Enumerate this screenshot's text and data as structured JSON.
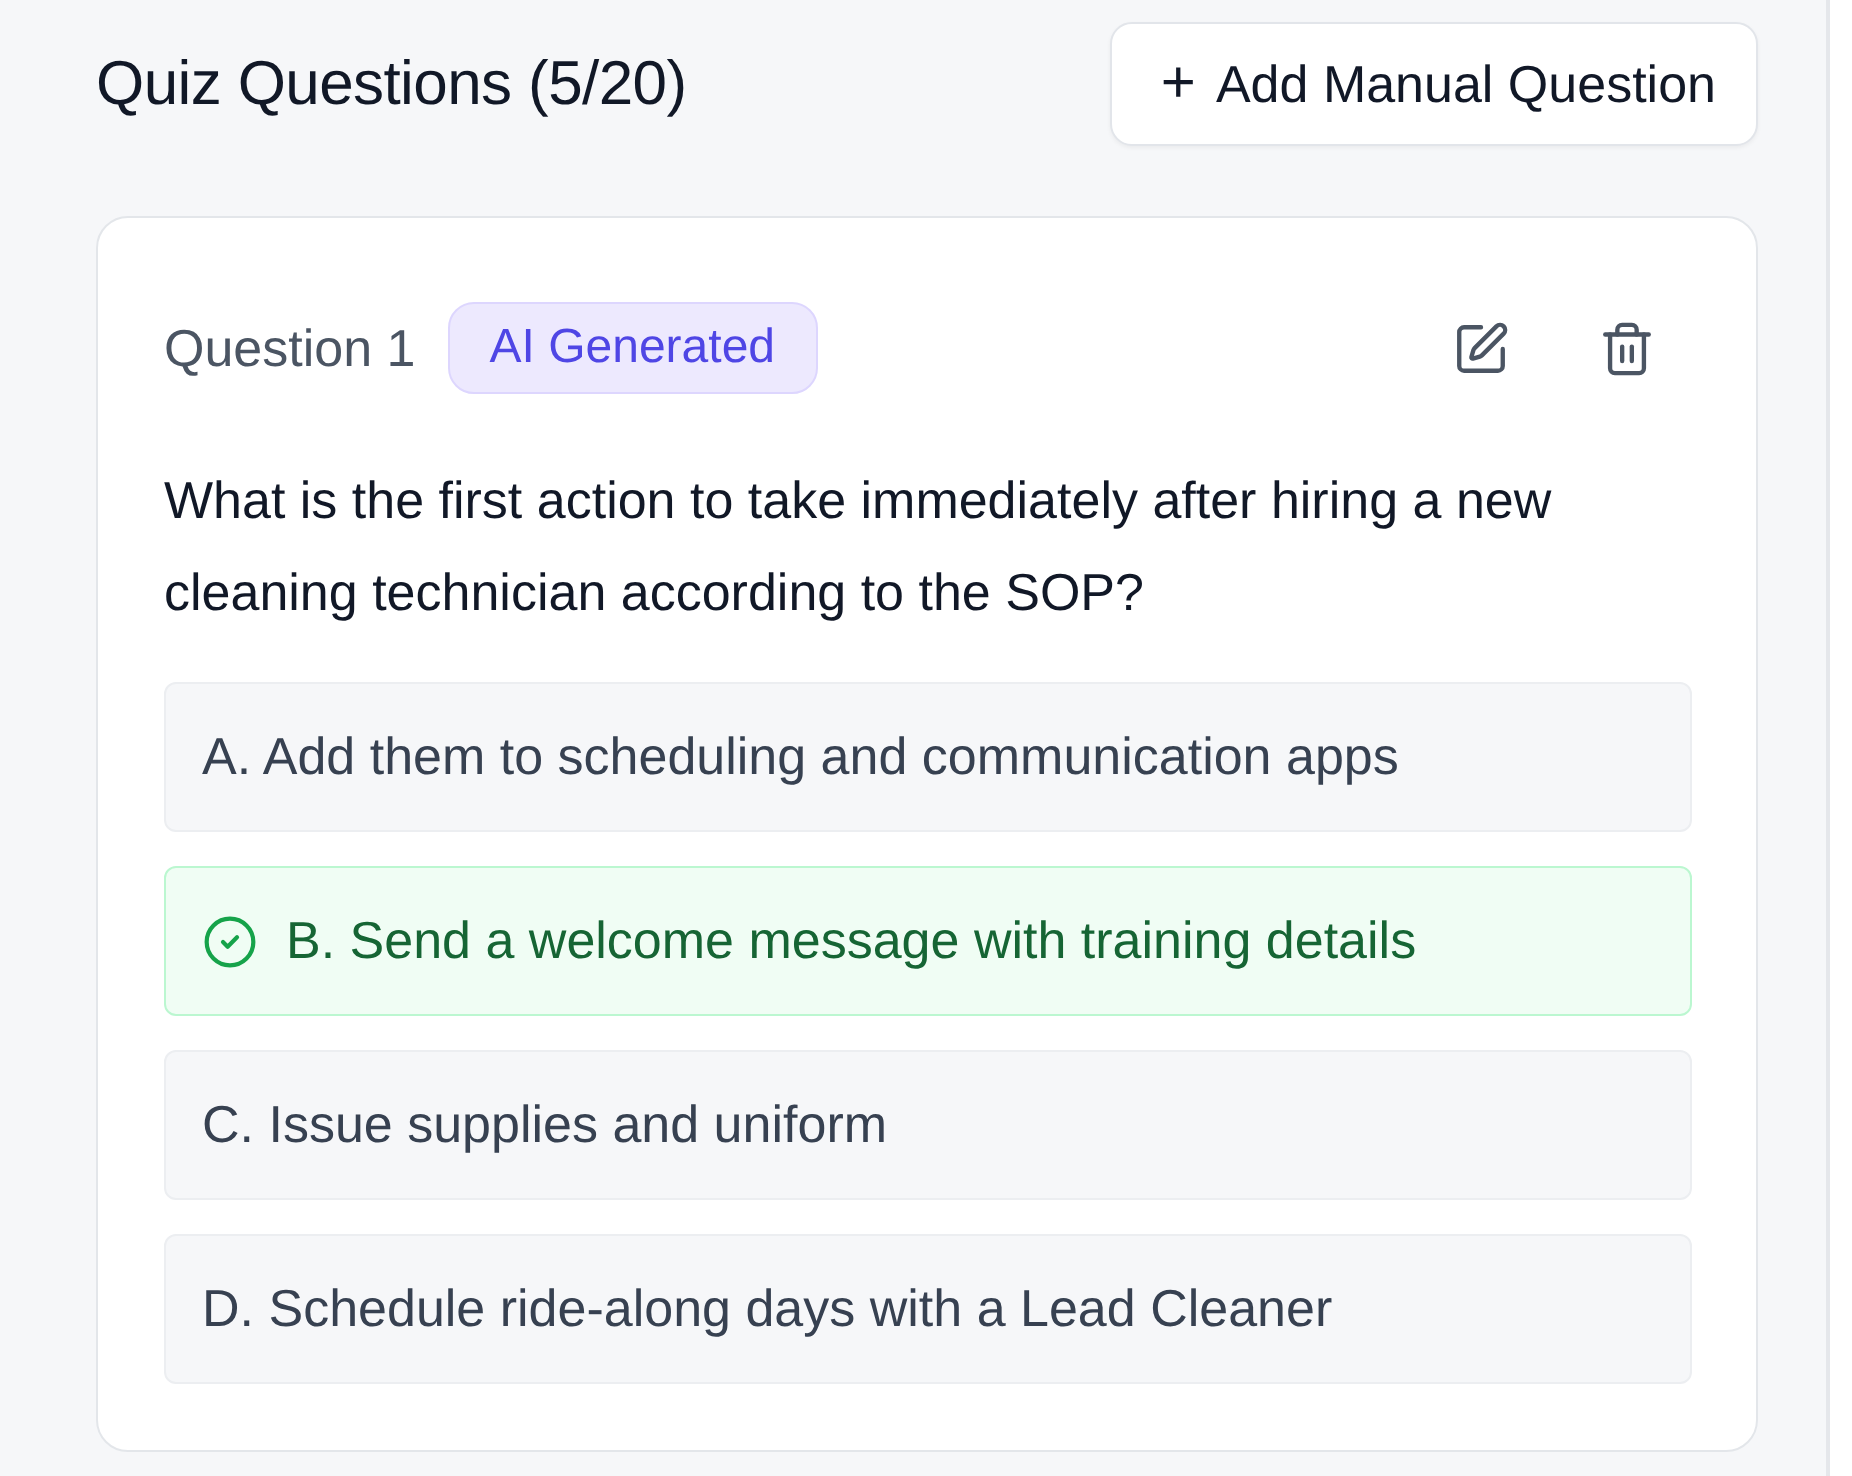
{
  "header": {
    "title": "Quiz Questions (5/20)",
    "add_button": {
      "icon": "+",
      "label": "Add Manual Question"
    }
  },
  "questions": [
    {
      "label": "Question 1",
      "badge": "AI Generated",
      "text": "What is the first action to take immediately after hiring a new cleaning technician according to the SOP?",
      "options": [
        {
          "text": "A. Add them to scheduling and communication apps",
          "correct": false
        },
        {
          "text": "B. Send a welcome message with training details",
          "correct": true
        },
        {
          "text": "C. Issue supplies and uniform",
          "correct": false
        },
        {
          "text": "D. Schedule ride-along days with a Lead Cleaner",
          "correct": false
        }
      ]
    }
  ]
}
